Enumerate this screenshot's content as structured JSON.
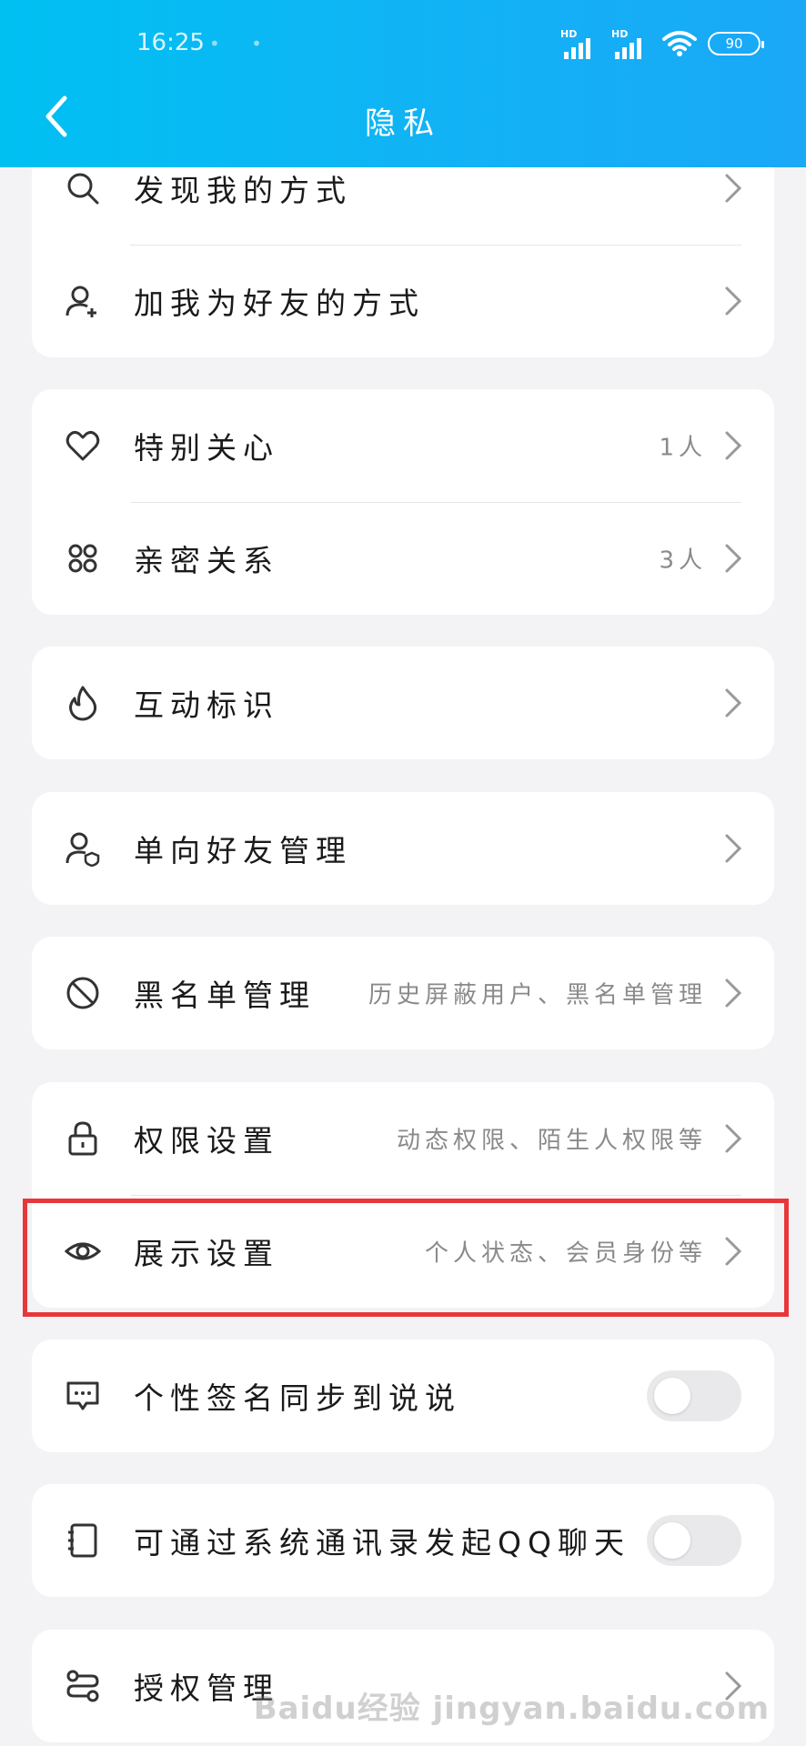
{
  "status_bar": {
    "time": "16:25",
    "indicators": "• •",
    "signal_1_label": "HD",
    "signal_2_label": "HD",
    "battery": "90"
  },
  "header": {
    "title": "隐私",
    "back_icon": "chevron-left-icon"
  },
  "groups": [
    {
      "rows": [
        {
          "icon": "search-icon",
          "label": "发现我的方式",
          "value": ""
        },
        {
          "icon": "add-user-icon",
          "label": "加我为好友的方式",
          "value": ""
        }
      ]
    },
    {
      "rows": [
        {
          "icon": "heart-icon",
          "label": "特别关心",
          "value": "1人"
        },
        {
          "icon": "intimate-relation-icon",
          "label": "亲密关系",
          "value": "3人"
        }
      ]
    },
    {
      "rows": [
        {
          "icon": "flame-icon",
          "label": "互动标识",
          "value": ""
        }
      ]
    },
    {
      "rows": [
        {
          "icon": "user-shield-icon",
          "label": "单向好友管理",
          "value": ""
        }
      ]
    },
    {
      "rows": [
        {
          "icon": "block-icon",
          "label": "黑名单管理",
          "value": "历史屏蔽用户、黑名单管理"
        }
      ]
    },
    {
      "rows": [
        {
          "icon": "lock-icon",
          "label": "权限设置",
          "value": "动态权限、陌生人权限等"
        },
        {
          "icon": "eye-icon",
          "label": "展示设置",
          "value": "个人状态、会员身份等"
        }
      ]
    },
    {
      "rows": [
        {
          "icon": "message-dots-icon",
          "label": "个性签名同步到说说",
          "toggle": false
        }
      ]
    },
    {
      "rows": [
        {
          "icon": "contact-book-icon",
          "label": "可通过系统通讯录发起QQ聊天",
          "toggle": false
        }
      ]
    },
    {
      "rows": [
        {
          "icon": "authorization-icon",
          "label": "授权管理",
          "value": ""
        }
      ]
    }
  ],
  "highlight": {
    "target": "展示设置",
    "color": "#e8373b"
  },
  "watermark": "Baidu经验 jingyan.baidu.com",
  "colors": {
    "header_start": "#00c0f2",
    "header_end": "#1aa8f7",
    "background": "#f3f3f5",
    "card": "#ffffff",
    "highlight": "#e8373b"
  }
}
